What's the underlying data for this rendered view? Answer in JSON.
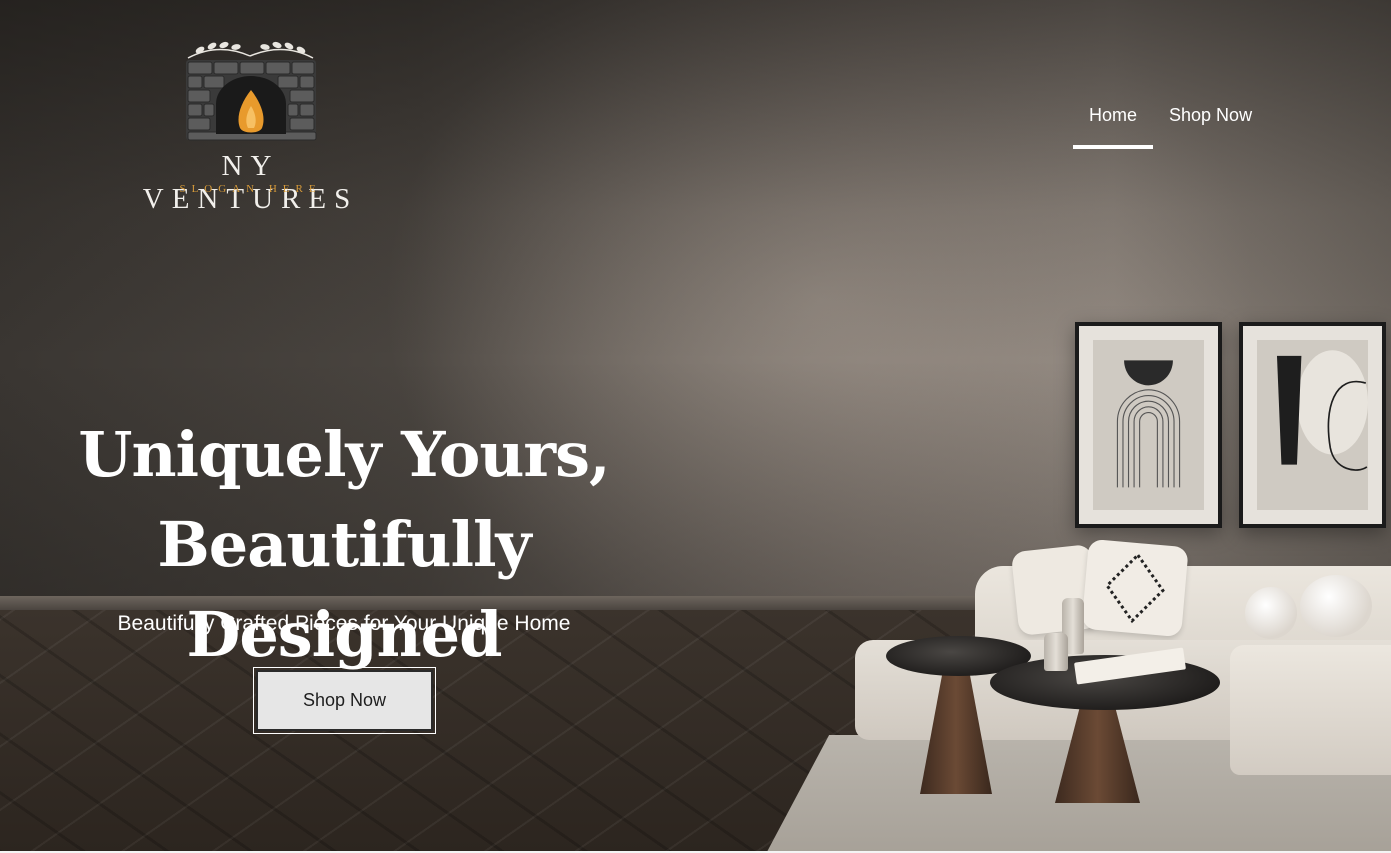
{
  "brand": {
    "name": "NY VENTURES",
    "slogan": "SLOGAN HERE",
    "logo_icon": "fireplace-icon",
    "accent_color": "#d79b3a"
  },
  "nav": {
    "items": [
      {
        "label": "Home",
        "active": true
      },
      {
        "label": "Shop Now",
        "active": false
      }
    ]
  },
  "hero": {
    "headline_line1": "Uniquely Yours,",
    "headline_line2": "Beautifully Designed",
    "subheadline": "Beautifully Crafted Pieces for Your Unique Home",
    "cta_label": "Shop Now"
  }
}
